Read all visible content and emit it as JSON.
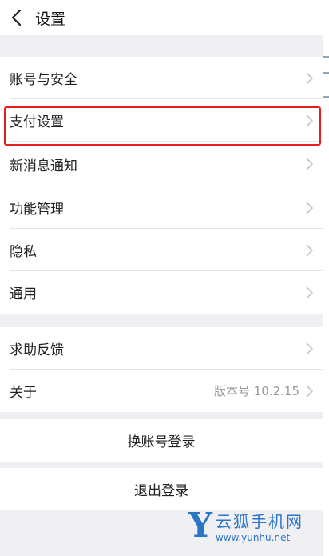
{
  "header": {
    "title": "设置",
    "back_icon": "chevron-left-icon"
  },
  "group1": {
    "items": [
      {
        "label": "账号与安全"
      },
      {
        "label": "支付设置"
      },
      {
        "label": "新消息通知"
      },
      {
        "label": "功能管理"
      },
      {
        "label": "隐私"
      },
      {
        "label": "通用"
      }
    ]
  },
  "group2": {
    "items": [
      {
        "label": "求助反馈"
      },
      {
        "label": "关于",
        "value": "版本号 10.2.15"
      }
    ]
  },
  "actions": {
    "switch_account": "换账号登录",
    "logout": "退出登录"
  },
  "watermark": {
    "name": "云狐手机网",
    "url": "www.yunhu.net",
    "letter": "Y"
  },
  "colors": {
    "background": "#efeff4",
    "highlight": "#e51f1f",
    "watermark": "#2a76c6",
    "chevron": "#c4c4c4"
  }
}
